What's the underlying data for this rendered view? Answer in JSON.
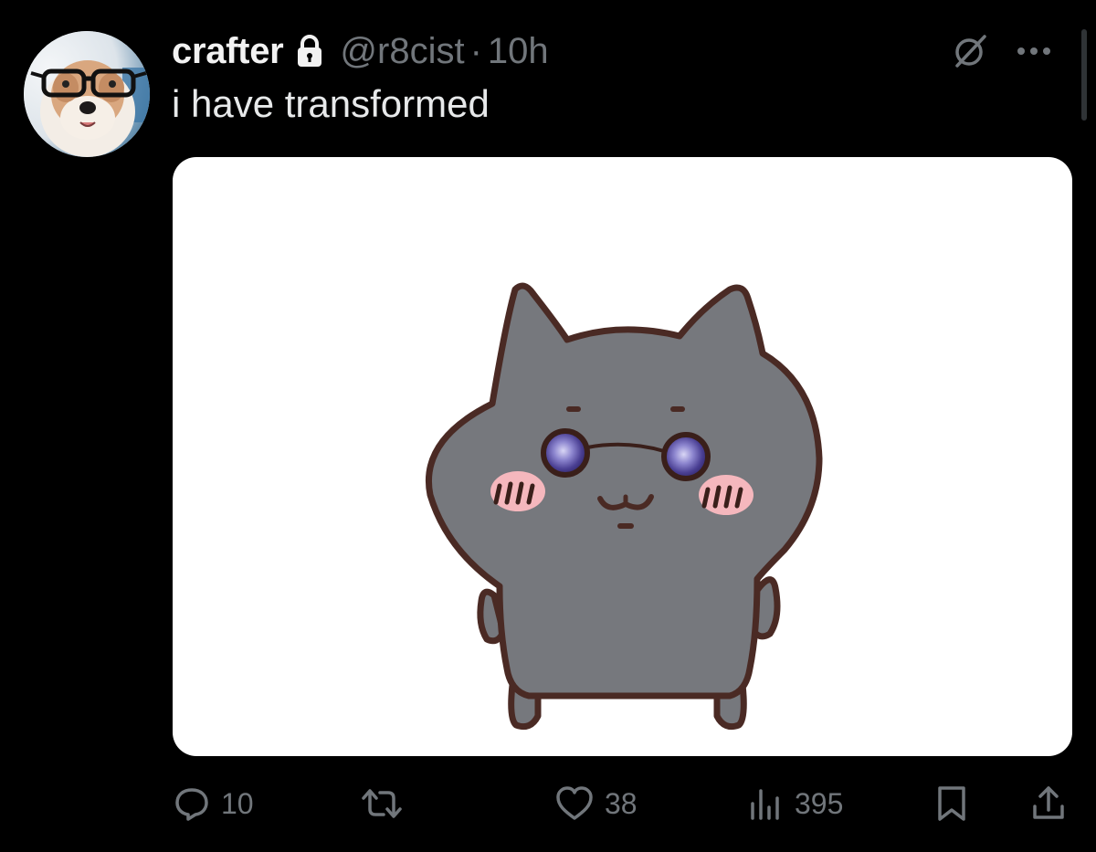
{
  "tweet": {
    "author_name": "crafter",
    "handle": "@r8cist",
    "separator": "·",
    "time": "10h",
    "text": "i have transformed"
  },
  "actions": {
    "replies": "10",
    "likes": "38",
    "views": "395"
  },
  "icons": {
    "lock": "lock-icon",
    "grok": "grok-icon",
    "more": "more-icon",
    "reply": "reply-icon",
    "retweet": "retweet-icon",
    "like": "heart-icon",
    "views": "views-icon",
    "bookmark": "bookmark-icon",
    "share": "share-icon"
  },
  "colors": {
    "background": "#000000",
    "text": "#e7e9ea",
    "muted": "#71767b",
    "media_background": "#ffffff",
    "cat_fill": "#76787d",
    "cat_outline": "#4a2a24",
    "blush": "#f5b7bd"
  }
}
